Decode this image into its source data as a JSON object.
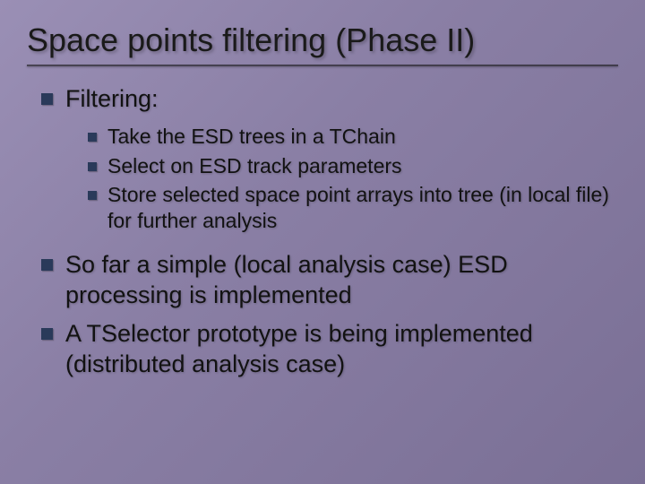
{
  "title": "Space points filtering (Phase II)",
  "items": [
    {
      "level": 1,
      "text": "Filtering:"
    },
    {
      "level": 2,
      "text": "Take the ESD trees in a TChain"
    },
    {
      "level": 2,
      "text": "Select on ESD track parameters"
    },
    {
      "level": 2,
      "text": "Store selected space point arrays into tree (in local file) for further analysis"
    },
    {
      "level": 1,
      "text": "So far a simple (local analysis case) ESD processing is implemented"
    },
    {
      "level": 1,
      "text": "A TSelector prototype is being implemented (distributed analysis case)"
    }
  ]
}
